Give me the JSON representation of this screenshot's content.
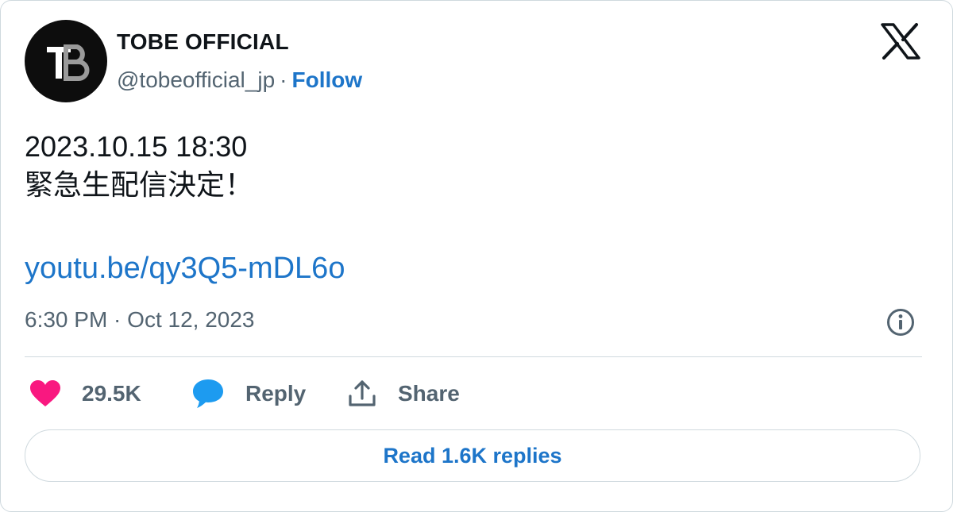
{
  "author": {
    "name": "TOBE OFFICIAL",
    "handle": "@tobeofficial_jp",
    "separator": "·",
    "follow_label": "Follow",
    "avatar_icon": "tobe-logo-avatar"
  },
  "brand_icon": "x-logo-icon",
  "tweet": {
    "lines": [
      "2023.10.15 18:30",
      "緊急生配信決定！"
    ],
    "link": "youtu.be/qy3Q5-mDL6o",
    "timestamp": "6:30 PM · Oct 12, 2023"
  },
  "actions": {
    "like_count": "29.5K",
    "reply_label": "Reply",
    "share_label": "Share"
  },
  "read_replies_label": "Read 1.6K replies",
  "colors": {
    "link": "#1d75c9",
    "like": "#f91880",
    "reply_icon": "#1d9bf0",
    "muted": "#536471",
    "border": "#cfd9de"
  }
}
